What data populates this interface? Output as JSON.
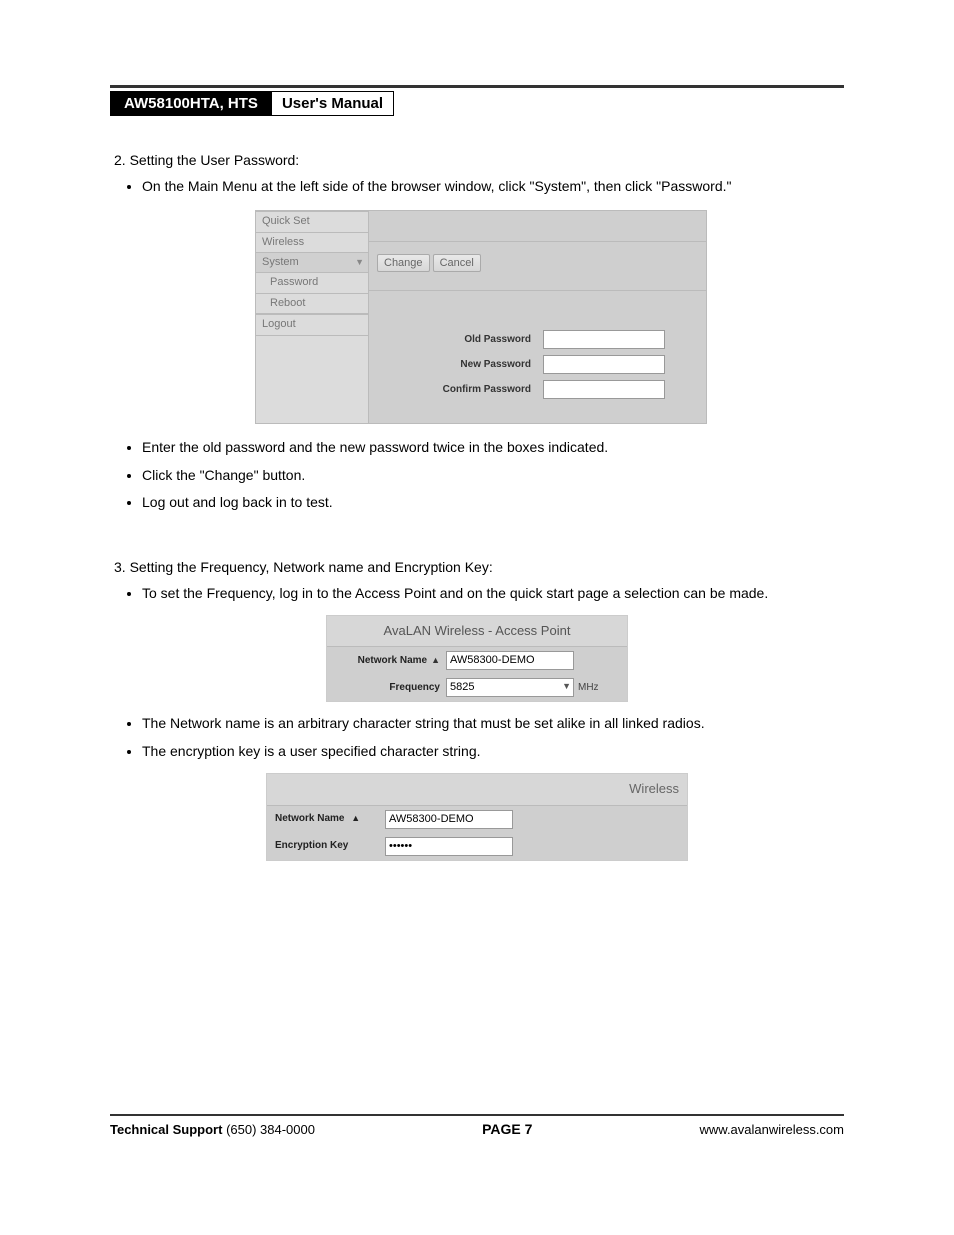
{
  "header": {
    "model": "AW58100HTA, HTS",
    "doc_title": "User's Manual"
  },
  "section2": {
    "title": "2. Setting the User Password:",
    "bullet_main": "On the Main Menu at the left side of the browser window, click \"System\", then click \"Password.\"",
    "menu": {
      "quickset": "Quick Set",
      "wireless": "Wireless",
      "system": "System",
      "password": "Password",
      "reboot": "Reboot",
      "logout": "Logout"
    },
    "buttons": {
      "change": "Change",
      "cancel": "Cancel"
    },
    "fields": {
      "old": "Old Password",
      "new": "New Password",
      "confirm": "Confirm Password"
    },
    "bullets_after": [
      "Enter the old password and the new password twice in the boxes indicated.",
      "Click the \"Change\" button.",
      "Log out and log back in to test."
    ]
  },
  "section3": {
    "title": "3. Setting the Frequency, Network name and Encryption Key:",
    "bullet1": "To set the Frequency, log in to the Access Point and on the quick start page a selection can be made.",
    "ap_panel": {
      "title": "AvaLAN Wireless - Access Point",
      "netname_label": "Network Name",
      "netname_value": "AW58300-DEMO",
      "freq_label": "Frequency",
      "freq_value": "5825",
      "freq_unit": "MHz"
    },
    "bullet2": "The Network name is an arbitrary character string that must be set alike in all linked radios.",
    "bullet3": "The encryption key is a user specified character string.",
    "wl_panel": {
      "title": "Wireless",
      "netname_label": "Network Name",
      "netname_value": "AW58300-DEMO",
      "enc_label": "Encryption Key",
      "enc_value": "••••••"
    }
  },
  "footer": {
    "support_label": "Technical Support",
    "support_phone": "(650) 384-0000",
    "page": "PAGE 7",
    "url": "www.avalanwireless.com"
  }
}
